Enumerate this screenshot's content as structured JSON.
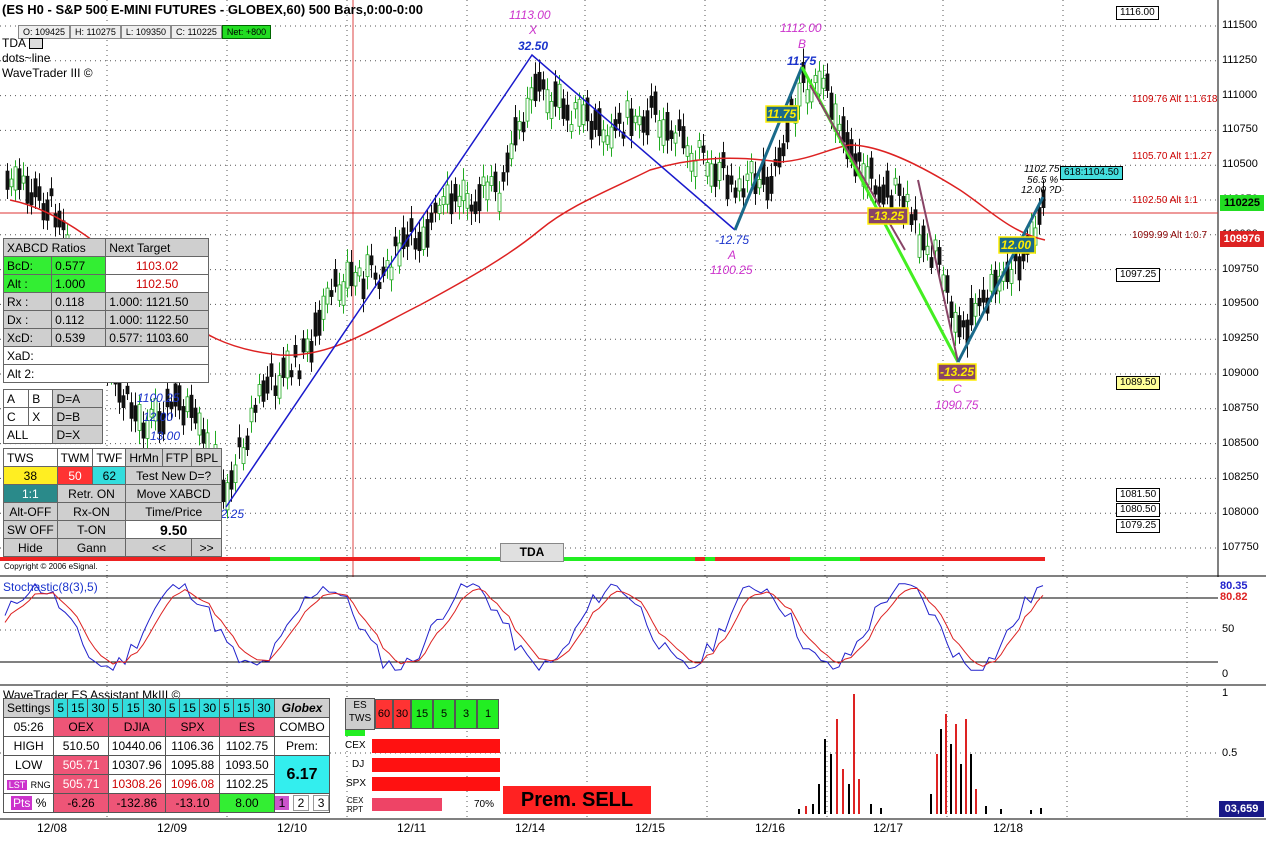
{
  "header": {
    "title": "(ES H0 - S&P 500 E-MINI FUTURES - GLOBEX,60) 500 Bars,0:00-0:00",
    "ohlc": {
      "open": "O: 109425",
      "high": "H: 110275",
      "low": "L: 109350",
      "close": "C: 110225",
      "net": "Net: +800"
    },
    "studies": [
      "TDA",
      "dots~line",
      "WaveTrader III ©"
    ]
  },
  "price_axis": {
    "ticks": [
      "111500",
      "111250",
      "111000",
      "110750",
      "110500",
      "110250",
      "110000",
      "109750",
      "109500",
      "109250",
      "109000",
      "108750",
      "108500",
      "108250",
      "108000",
      "107750"
    ],
    "current_price": "110225",
    "ma_price": "109976",
    "stoch_top": "80.35",
    "stoch_ma": "80.82",
    "stoch_ticks": [
      "50",
      "0"
    ],
    "vol_ticks": [
      "1",
      "0.5"
    ],
    "vol_value": "03,659"
  },
  "date_axis": [
    "12/08",
    "12/09",
    "12/10",
    "12/11",
    "12/14",
    "12/15",
    "12/16",
    "12/17",
    "12/18"
  ],
  "right_boxes": {
    "b1116": "1116.00",
    "b1097": "1097.25",
    "b1089": "1089.50",
    "b1081": "1081.50",
    "b1080": "1080.50",
    "b1079": "1079.25",
    "b618": "618:1104.50"
  },
  "alt_labels": {
    "a1": "1109.76 Alt 1:1.618",
    "a2": "1105.70 Alt 1:1.27",
    "a3": "1102.50 Alt 1:1",
    "a4": "1099.99 Alt 1:0.7"
  },
  "pattern": {
    "x_price": "1113.00",
    "x_name": "X",
    "x_move": "32.50",
    "b_price": "1112.00",
    "b_name": "B",
    "b_move": "11.75",
    "a_move": "-12.75",
    "a_name": "A",
    "a_price": "1100.25",
    "c_move": "-13.25",
    "c_name": "C",
    "c_price": "1090.75",
    "start_move": "-12.25",
    "leg1": "11.75",
    "leg2": "-13.25",
    "leg3": "12.00",
    "d_price": "1102.75",
    "d_pct": "56.5 %",
    "d_proj": "12.00 ?D",
    "left_a": "1100.25",
    "left_b": "12.00",
    "left_c": "13.00"
  },
  "xabcd_panel": {
    "title": "XABCD Ratios",
    "next_target": "Next Target",
    "bcd_label": "BcD:",
    "bcd_value": "0.577",
    "bcd_target": "1103.02",
    "alt_label": "Alt :",
    "alt_value": "1.000",
    "alt_target": "1102.50",
    "rx_label": "Rx  :",
    "rx_value": "0.118",
    "rx_target": "1.000: 1121.50",
    "dx_label": "Dx  :",
    "dx_value": "0.112",
    "dx_target": "1.000: 1122.50",
    "xcd_label": "XcD:",
    "xcd_value": "0.539",
    "xcd_target": "0.577: 1103.60",
    "xad_label": "XaD:",
    "alt2_label": "Alt 2:",
    "btn_a": "A",
    "btn_b": "B",
    "btn_da": "D=A",
    "btn_c": "C",
    "btn_x": "X",
    "btn_db": "D=B",
    "btn_all": "ALL",
    "btn_dx": "D=X",
    "tws": "TWS",
    "twm": "TWM",
    "twf": "TWF",
    "hrmn": "HrMn",
    "ftp": "FTP",
    "bpl": "BPL",
    "v38": "38",
    "v50": "50",
    "v62": "62",
    "test_new": "Test New D=?",
    "ratio11": "1:1",
    "retr_on": "Retr. ON",
    "move_xabcd": "Move XABCD",
    "alt_off": "Alt-OFF",
    "rx_on": "Rx-ON",
    "time_price": "Time/Price",
    "sw_off": "SW OFF",
    "t_on": "T-ON",
    "value_950": "9.50",
    "hide": "Hide",
    "gann": "Gann",
    "prev": "<<",
    "next": ">>"
  },
  "tda_button": "TDA",
  "copyright": "Copyright © 2006 eSignal.",
  "stochastic": {
    "title": "Stochastic(8(3),5)"
  },
  "assistant": {
    "title": "WaveTrader ES Assistant MkIII ©",
    "settings": "Settings",
    "m5": "5",
    "m15": "15",
    "m30": "30",
    "globex": "Globex",
    "time": "05:26",
    "oex": "OEX",
    "djia": "DJIA",
    "spx": "SPX",
    "es": "ES",
    "combo": "COMBO",
    "high_label": "HIGH",
    "high_oex": "510.50",
    "high_djia": "10440.06",
    "high_spx": "1106.36",
    "high_es": "1102.75",
    "prem_label": "Prem:",
    "low_label": "LOW",
    "low_oex": "505.71",
    "low_djia": "10307.96",
    "low_spx": "1095.88",
    "low_es": "1093.50",
    "prem_value": "6.17",
    "lst": "LST",
    "rng": "RNG",
    "lst_oex": "505.71",
    "lst_djia": "10308.26",
    "lst_spx": "1096.08",
    "lst_es": "1102.25",
    "pts": "Pts",
    "pct": "%",
    "pts_oex": "-6.26",
    "pts_djia": "-132.86",
    "pts_spx": "-13.10",
    "pts_es": "8.00",
    "b1": "1",
    "b2": "2",
    "b3": "3",
    "es_tws": "ES TWS",
    "t60": "60",
    "t30": "30",
    "t15": "15",
    "t5": "5",
    "t3": "3",
    "t1": "1",
    "cex": "CEX",
    "dj": "DJ",
    "spx_bar": "SPX",
    "cex_rpt": "CEX RPT",
    "rpt_pct": "70%",
    "prem_sell": "Prem. SELL"
  },
  "colors": {
    "ma_line": "#dd2222",
    "pattern_blue": "#1a1acc",
    "pattern_green": "#44ee22",
    "pattern_teal": "#1a6a8a",
    "candle_up": "#22aa22",
    "candle_down": "#111111",
    "label_magenta": "#cc33cc"
  }
}
